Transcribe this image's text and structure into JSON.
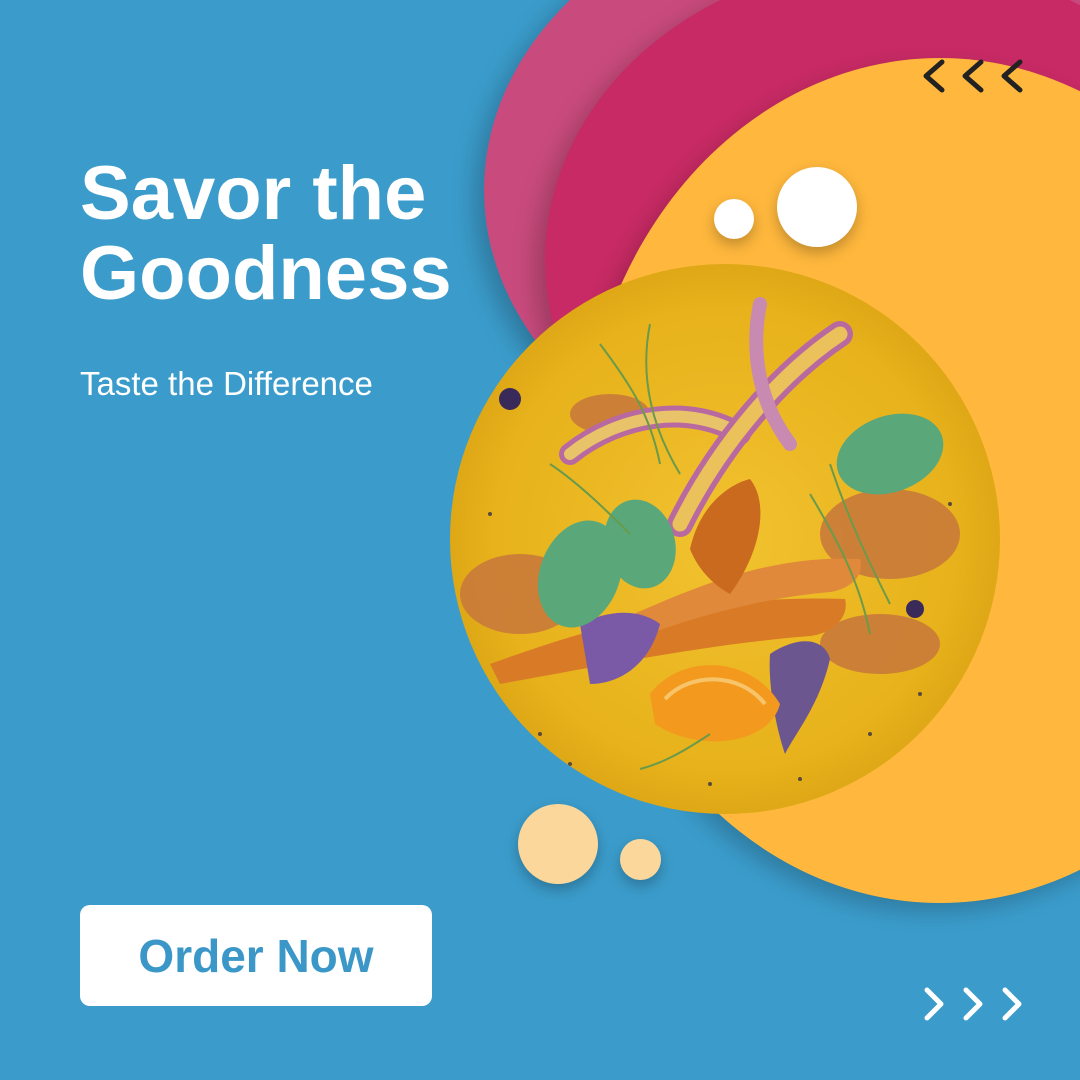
{
  "headline": {
    "line1": "Savor the",
    "line2": "Goodness"
  },
  "tagline": "Taste the Difference",
  "cta": {
    "label": "Order Now"
  },
  "colors": {
    "background": "#3b9ccb",
    "pink_back": "#c94b7d",
    "pink_front": "#c72a64",
    "orange": "#ffb83d",
    "white_bubble": "#ffffff",
    "peach_bubble": "#fcd79b",
    "button_text": "#3b97c8",
    "chevron_dark": "#222222",
    "chevron_light": "#ffffff"
  },
  "icons": {
    "top": "chevrons-left-icon",
    "bottom": "chevrons-right-icon",
    "photo": "food-plate-photo"
  }
}
